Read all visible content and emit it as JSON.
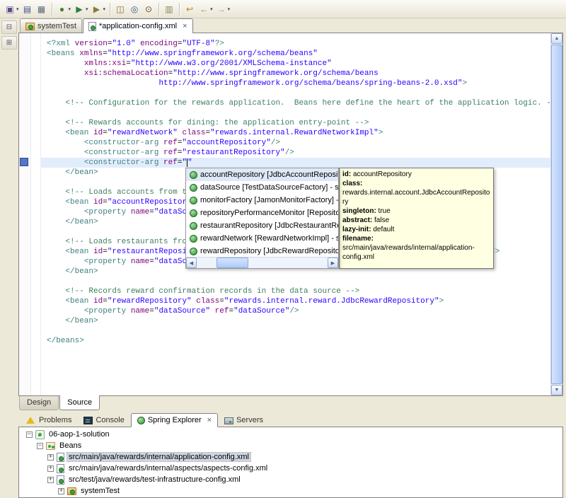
{
  "glyphs": {
    "close": "×",
    "dropdown": "▾",
    "plus": "+",
    "minus": "−",
    "scroll_up": "▲",
    "scroll_down": "▼",
    "scroll_left": "◀",
    "scroll_right": "▶"
  },
  "colors": {
    "tag": "#3f7f7f",
    "attribute": "#7f007f",
    "value": "#2a00ff",
    "comment": "#3f7f5f",
    "current_line": "#e2edfc",
    "tooltip_bg": "#ffffe1",
    "selection": "#dfe8f6"
  },
  "toolbar": {
    "items": [
      {
        "name": "new-wizard-button",
        "glyph": "▣",
        "color": "#5b4a8a",
        "dropdown": true
      },
      {
        "name": "save-button",
        "glyph": "▤",
        "color": "#44518c"
      },
      {
        "name": "print-button",
        "glyph": "▦",
        "color": "#5a6b7a"
      },
      {
        "sep": true
      },
      {
        "name": "debug-button",
        "glyph": "●",
        "color": "#4f7d2f",
        "dropdown": true
      },
      {
        "name": "run-button",
        "glyph": "▶",
        "color": "#2f7d3f",
        "dropdown": true
      },
      {
        "name": "external-tools-button",
        "glyph": "▶",
        "color": "#8a7a3a",
        "dropdown": true
      },
      {
        "sep": true
      },
      {
        "name": "new-java-project-button",
        "glyph": "◫",
        "color": "#8a6a2a"
      },
      {
        "name": "open-type-button",
        "glyph": "◎",
        "color": "#3a5a8a"
      },
      {
        "name": "search-button",
        "glyph": "⊙",
        "color": "#6a4a2a"
      },
      {
        "sep": true
      },
      {
        "name": "toggle-mark-occurrences-button",
        "glyph": "▥",
        "color": "#888855"
      },
      {
        "sep": true
      },
      {
        "name": "last-edit-location-button",
        "glyph": "↩",
        "color": "#b08a00"
      },
      {
        "name": "back-button",
        "glyph": "←",
        "color": "#b08a00",
        "dropdown": true
      },
      {
        "name": "forward-button",
        "glyph": "→",
        "color": "#9a9a8a",
        "dropdown": true
      }
    ]
  },
  "fast_view_icons": [
    {
      "name": "restore-view-icon",
      "glyph": "⊟"
    },
    {
      "name": "outline-view-icon",
      "glyph": "⊞"
    }
  ],
  "editor_tabs": [
    {
      "label": "systemTest",
      "icon": "config-set-icon",
      "active": false
    },
    {
      "label": "*application-config.xml",
      "icon": "bean-config-file-icon",
      "active": true,
      "closable": true
    }
  ],
  "code": {
    "lines": [
      {
        "segs": [
          [
            "t",
            "<?xml "
          ],
          [
            "a",
            "version"
          ],
          [
            "p",
            "="
          ],
          [
            "v",
            "\"1.0\""
          ],
          [
            "p",
            " "
          ],
          [
            "a",
            "encoding"
          ],
          [
            "p",
            "="
          ],
          [
            "v",
            "\"UTF-8\""
          ],
          [
            "t",
            "?>"
          ]
        ]
      },
      {
        "segs": [
          [
            "t",
            "<beans "
          ],
          [
            "a",
            "xmlns"
          ],
          [
            "p",
            "="
          ],
          [
            "v",
            "\"http://www.springframework.org/schema/beans\""
          ]
        ]
      },
      {
        "segs": [
          [
            "p",
            "        "
          ],
          [
            "a",
            "xmlns:xsi"
          ],
          [
            "p",
            "="
          ],
          [
            "v",
            "\"http://www.w3.org/2001/XMLSchema-instance\""
          ]
        ]
      },
      {
        "segs": [
          [
            "p",
            "        "
          ],
          [
            "a",
            "xsi:schemaLocation"
          ],
          [
            "p",
            "="
          ],
          [
            "v",
            "\"http://www.springframework.org/schema/beans"
          ]
        ]
      },
      {
        "segs": [
          [
            "p",
            "                        "
          ],
          [
            "v",
            "http://www.springframework.org/schema/beans/spring-beans-2.0.xsd\""
          ],
          [
            "t",
            ">"
          ]
        ]
      },
      {
        "segs": []
      },
      {
        "segs": [
          [
            "p",
            "    "
          ],
          [
            "c",
            "<!-- Configuration for the rewards application.  Beans here define the heart of the application logic. -->"
          ]
        ]
      },
      {
        "segs": []
      },
      {
        "segs": [
          [
            "p",
            "    "
          ],
          [
            "c",
            "<!-- Rewards accounts for dining: the application entry-point -->"
          ]
        ]
      },
      {
        "segs": [
          [
            "p",
            "    "
          ],
          [
            "t",
            "<bean "
          ],
          [
            "a",
            "id"
          ],
          [
            "p",
            "="
          ],
          [
            "v",
            "\"rewardNetwork\""
          ],
          [
            "p",
            " "
          ],
          [
            "a",
            "class"
          ],
          [
            "p",
            "="
          ],
          [
            "v",
            "\"rewards.internal.RewardNetworkImpl\""
          ],
          [
            "t",
            ">"
          ]
        ]
      },
      {
        "segs": [
          [
            "p",
            "        "
          ],
          [
            "t",
            "<constructor-arg "
          ],
          [
            "a",
            "ref"
          ],
          [
            "p",
            "="
          ],
          [
            "v",
            "\"accountRepository\""
          ],
          [
            "t",
            "/>"
          ]
        ]
      },
      {
        "segs": [
          [
            "p",
            "        "
          ],
          [
            "t",
            "<constructor-arg "
          ],
          [
            "a",
            "ref"
          ],
          [
            "p",
            "="
          ],
          [
            "v",
            "\"restaurantRepository\""
          ],
          [
            "t",
            "/>"
          ]
        ]
      },
      {
        "cur": true,
        "segs": [
          [
            "p",
            "        "
          ],
          [
            "t",
            "<constructor-arg "
          ],
          [
            "a",
            "ref"
          ],
          [
            "p",
            "="
          ],
          [
            "v",
            "\""
          ],
          [
            "cursor",
            ""
          ],
          [
            "v",
            "\""
          ]
        ]
      },
      {
        "segs": [
          [
            "p",
            "    "
          ],
          [
            "t",
            "</bean>"
          ]
        ]
      },
      {
        "segs": []
      },
      {
        "segs": [
          [
            "p",
            "    "
          ],
          [
            "c",
            "<!-- Loads accounts from the data source -->"
          ]
        ]
      },
      {
        "segs": [
          [
            "p",
            "    "
          ],
          [
            "t",
            "<bean "
          ],
          [
            "a",
            "id"
          ],
          [
            "p",
            "="
          ],
          [
            "v",
            "\"accountRepository\""
          ],
          [
            "p",
            " "
          ],
          [
            "a",
            "class"
          ],
          [
            "p",
            "="
          ],
          [
            "v",
            "\"rewards.internal.account.JdbcAccountRepository\""
          ],
          [
            "t",
            ">"
          ]
        ]
      },
      {
        "segs": [
          [
            "p",
            "        "
          ],
          [
            "t",
            "<property "
          ],
          [
            "a",
            "name"
          ],
          [
            "p",
            "="
          ],
          [
            "v",
            "\"dataSource\""
          ],
          [
            "p",
            " "
          ],
          [
            "a",
            "ref"
          ],
          [
            "p",
            "="
          ],
          [
            "v",
            "\"dataSource\""
          ],
          [
            "t",
            "/>"
          ]
        ]
      },
      {
        "segs": [
          [
            "p",
            "    "
          ],
          [
            "t",
            "</bean>"
          ]
        ]
      },
      {
        "segs": []
      },
      {
        "segs": [
          [
            "p",
            "    "
          ],
          [
            "c",
            "<!-- Loads restaurants from the data source -->"
          ]
        ]
      },
      {
        "segs": [
          [
            "p",
            "    "
          ],
          [
            "t",
            "<bean "
          ],
          [
            "a",
            "id"
          ],
          [
            "p",
            "="
          ],
          [
            "v",
            "\"restaurantRepository\""
          ],
          [
            "p",
            " "
          ],
          [
            "a",
            "class"
          ],
          [
            "p",
            "="
          ],
          [
            "v",
            "\"rewards.internal.restaurant.JdbcRestaurantRepository\""
          ],
          [
            "t",
            ">"
          ]
        ]
      },
      {
        "segs": [
          [
            "p",
            "        "
          ],
          [
            "t",
            "<property "
          ],
          [
            "a",
            "name"
          ],
          [
            "p",
            "="
          ],
          [
            "v",
            "\"dataSource\""
          ],
          [
            "p",
            " "
          ],
          [
            "a",
            "ref"
          ],
          [
            "p",
            "="
          ],
          [
            "v",
            "\"dataSource\""
          ],
          [
            "t",
            "/>"
          ]
        ]
      },
      {
        "segs": [
          [
            "p",
            "    "
          ],
          [
            "t",
            "</bean>"
          ]
        ]
      },
      {
        "segs": []
      },
      {
        "segs": [
          [
            "p",
            "    "
          ],
          [
            "c",
            "<!-- Records reward confirmation records in the data source -->"
          ]
        ]
      },
      {
        "segs": [
          [
            "p",
            "    "
          ],
          [
            "t",
            "<bean "
          ],
          [
            "a",
            "id"
          ],
          [
            "p",
            "="
          ],
          [
            "v",
            "\"rewardRepository\""
          ],
          [
            "p",
            " "
          ],
          [
            "a",
            "class"
          ],
          [
            "p",
            "="
          ],
          [
            "v",
            "\"rewards.internal.reward.JdbcRewardRepository\""
          ],
          [
            "t",
            ">"
          ]
        ]
      },
      {
        "segs": [
          [
            "p",
            "        "
          ],
          [
            "t",
            "<property "
          ],
          [
            "a",
            "name"
          ],
          [
            "p",
            "="
          ],
          [
            "v",
            "\"dataSource\""
          ],
          [
            "p",
            " "
          ],
          [
            "a",
            "ref"
          ],
          [
            "p",
            "="
          ],
          [
            "v",
            "\"dataSource\""
          ],
          [
            "t",
            "/>"
          ]
        ]
      },
      {
        "segs": [
          [
            "p",
            "    "
          ],
          [
            "t",
            "</bean>"
          ]
        ]
      },
      {
        "segs": []
      },
      {
        "segs": [
          [
            "t",
            "</beans>"
          ]
        ]
      }
    ]
  },
  "completion": {
    "selected_index": 0,
    "items": [
      "accountRepository [JdbcAccountRepository] - src/m",
      "dataSource [TestDataSourceFactory] - src/test/ja",
      "monitorFactory [JamonMonitorFactory] - src/main",
      "repositoryPerformanceMonitor [RepositoryPerfor",
      "restaurantRepository [JdbcRestaurantRepository",
      "rewardNetwork [RewardNetworkImpl] - src/main/j",
      "rewardRepository [JdbcRewardRepository] - src/r"
    ]
  },
  "tooltip": {
    "fields": [
      {
        "label": "id:",
        "value": " accountRepository"
      },
      {
        "label": "class:",
        "value": " rewards.internal.account.JdbcAccountRepository"
      },
      {
        "label": "singleton:",
        "value": " true"
      },
      {
        "label": "abstract:",
        "value": " false"
      },
      {
        "label": "lazy-init:",
        "value": " default"
      },
      {
        "label": "filename:",
        "value": " src/main/java/rewards/internal/application-config.xml"
      }
    ]
  },
  "footer_tabs": [
    {
      "label": "Design",
      "active": false
    },
    {
      "label": "Source",
      "active": true
    }
  ],
  "bottom_panel": {
    "tabs": [
      {
        "label": "Problems",
        "icon": "problems-icon"
      },
      {
        "label": "Console",
        "icon": "console-icon"
      },
      {
        "label": "Spring Explorer",
        "icon": "spring-icon",
        "active": true,
        "closable": true
      },
      {
        "label": "Servers",
        "icon": "servers-icon"
      }
    ],
    "tree": [
      {
        "label": "06-aop-1-solution",
        "level": 0,
        "expander": "minus",
        "icon": "spring-project-icon"
      },
      {
        "label": "Beans",
        "level": 1,
        "expander": "minus",
        "icon": "beans-node-icon"
      },
      {
        "label": "src/main/java/rewards/internal/application-config.xml",
        "level": 2,
        "expander": "plus",
        "icon": "bean-config-file-icon",
        "selected": true
      },
      {
        "label": "src/main/java/rewards/internal/aspects/aspects-config.xml",
        "level": 2,
        "expander": "plus",
        "icon": "bean-config-file-icon"
      },
      {
        "label": "src/test/java/rewards/test-infrastructure-config.xml",
        "level": 2,
        "expander": "plus",
        "icon": "bean-config-file-icon"
      },
      {
        "label": "systemTest",
        "level": 3,
        "expander": "plus",
        "icon": "config-set-icon"
      }
    ]
  }
}
